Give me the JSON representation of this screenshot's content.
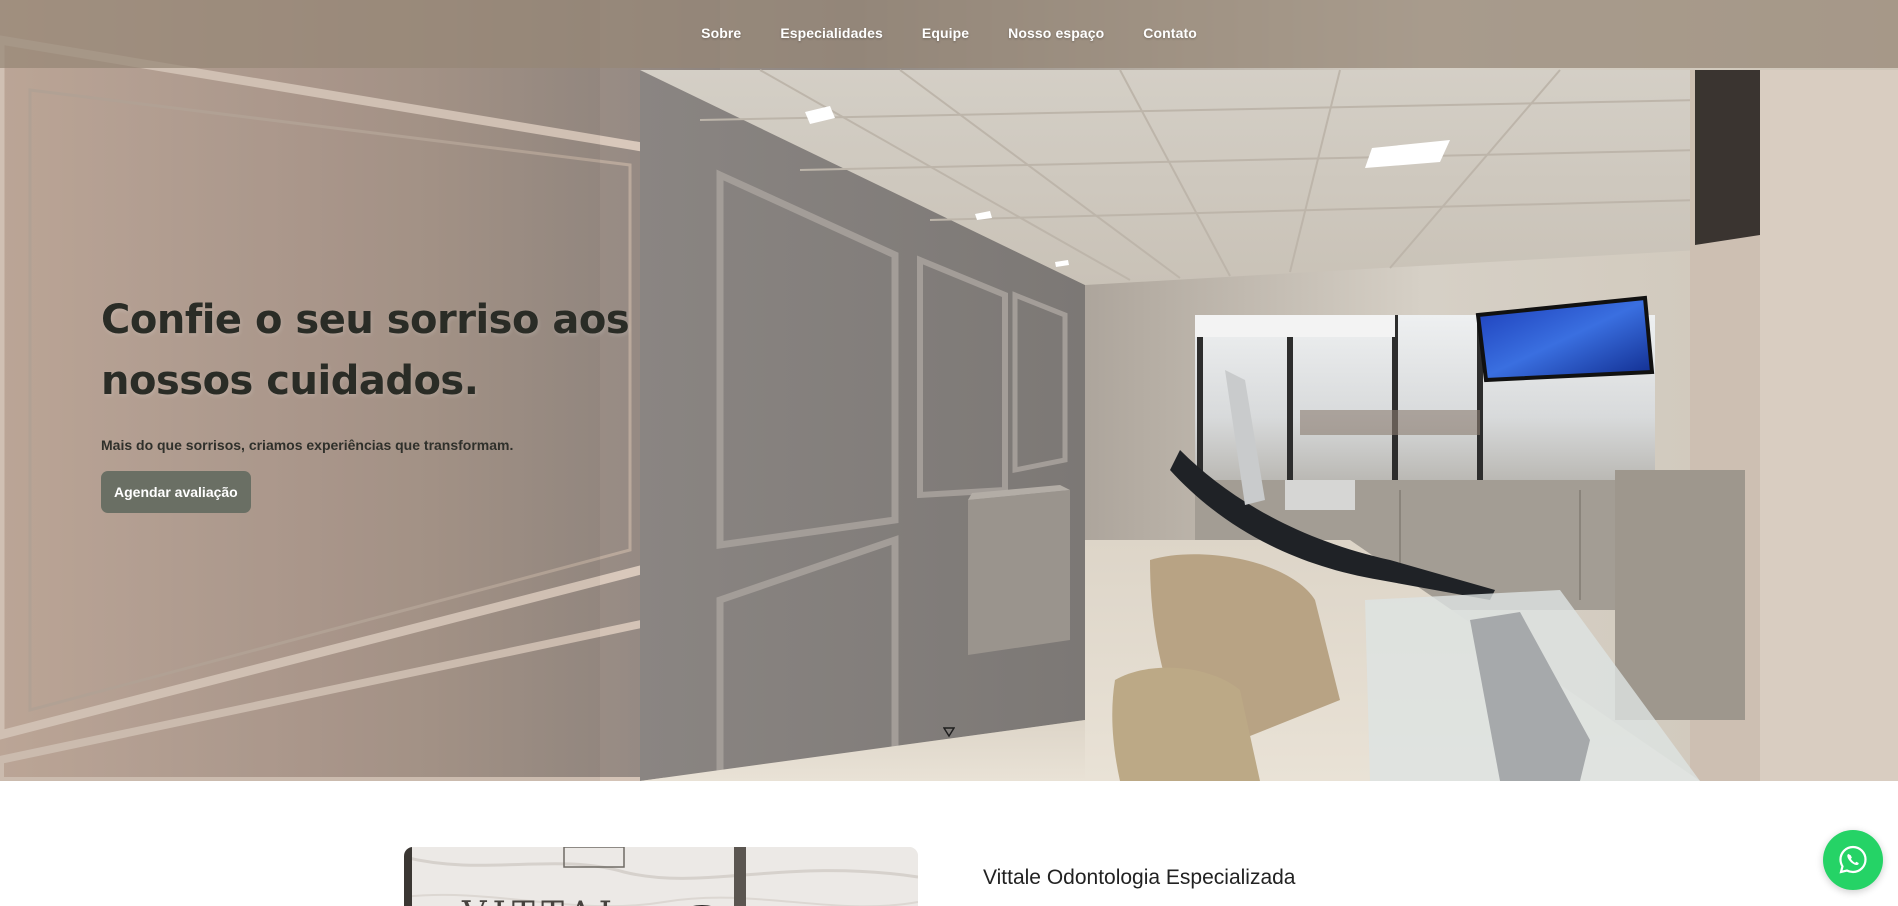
{
  "nav": {
    "items": [
      {
        "label": "Sobre"
      },
      {
        "label": "Especialidades"
      },
      {
        "label": "Equipe"
      },
      {
        "label": "Nosso espaço"
      },
      {
        "label": "Contato"
      }
    ]
  },
  "hero": {
    "title": "Confie o seu sorriso aos nossos cuidados.",
    "subtitle": "Mais do que sorrisos, criamos experiências que transformam.",
    "cta_label": "Agendar avaliação"
  },
  "about": {
    "heading": "Vittale Odontologia Especializada",
    "photo_sign_text": "VITTAL"
  },
  "icons": {
    "scroll": "scroll-down-icon",
    "whatsapp": "whatsapp-icon"
  },
  "colors": {
    "nav_background": "#968676",
    "cta_background": "#6a6f64",
    "whatsapp_green": "#25d366",
    "heading_text": "#2a2c26"
  }
}
